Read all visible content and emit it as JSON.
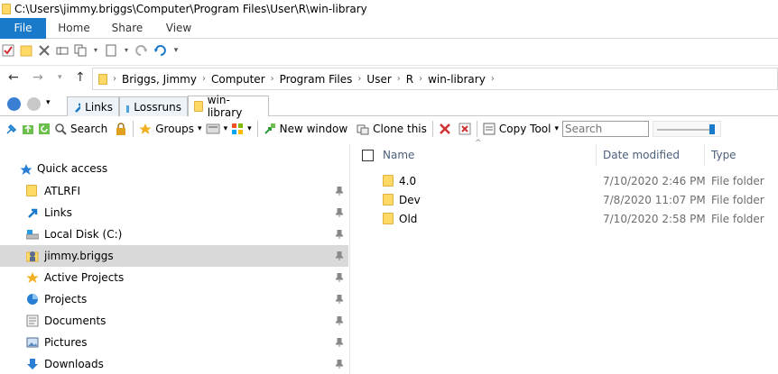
{
  "window": {
    "title": "C:\\Users\\jimmy.briggs\\Computer\\Program Files\\User\\R\\win-library"
  },
  "ribbon": {
    "tabs": [
      "File",
      "Home",
      "Share",
      "View"
    ]
  },
  "address": {
    "crumbs": [
      "Briggs, Jimmy",
      "Computer",
      "Program Files",
      "User",
      "R",
      "win-library"
    ]
  },
  "qttabs": [
    {
      "label": "Links"
    },
    {
      "label": "Lossruns"
    },
    {
      "label": "win-library"
    }
  ],
  "toolbar": {
    "search_label": "Search",
    "groups_label": "Groups",
    "new_window_label": "New window",
    "clone_label": "Clone this",
    "copy_tool_label": "Copy Tool",
    "search_placeholder": "Search"
  },
  "nav": {
    "quick_access": "Quick access",
    "items": [
      {
        "label": "ATLRFI",
        "icon": "folder-icon"
      },
      {
        "label": "Links",
        "icon": "links-icon"
      },
      {
        "label": "Local Disk (C:)",
        "icon": "drive-icon"
      },
      {
        "label": "jimmy.briggs",
        "icon": "user-folder-icon"
      },
      {
        "label": "Active Projects",
        "icon": "star-icon"
      },
      {
        "label": "Projects",
        "icon": "pie-icon"
      },
      {
        "label": "Documents",
        "icon": "documents-icon"
      },
      {
        "label": "Pictures",
        "icon": "pictures-icon"
      },
      {
        "label": "Downloads",
        "icon": "downloads-icon"
      }
    ]
  },
  "files": {
    "columns": {
      "name": "Name",
      "date": "Date modified",
      "type": "Type"
    },
    "rows": [
      {
        "name": "4.0",
        "date": "7/10/2020 2:46 PM",
        "type": "File folder"
      },
      {
        "name": "Dev",
        "date": "7/8/2020 11:07 PM",
        "type": "File folder"
      },
      {
        "name": "Old",
        "date": "7/10/2020 2:58 PM",
        "type": "File folder"
      }
    ]
  },
  "colors": {
    "accent": "#1979ca",
    "folder": "#ffd966",
    "selected": "#d9d9d9"
  }
}
